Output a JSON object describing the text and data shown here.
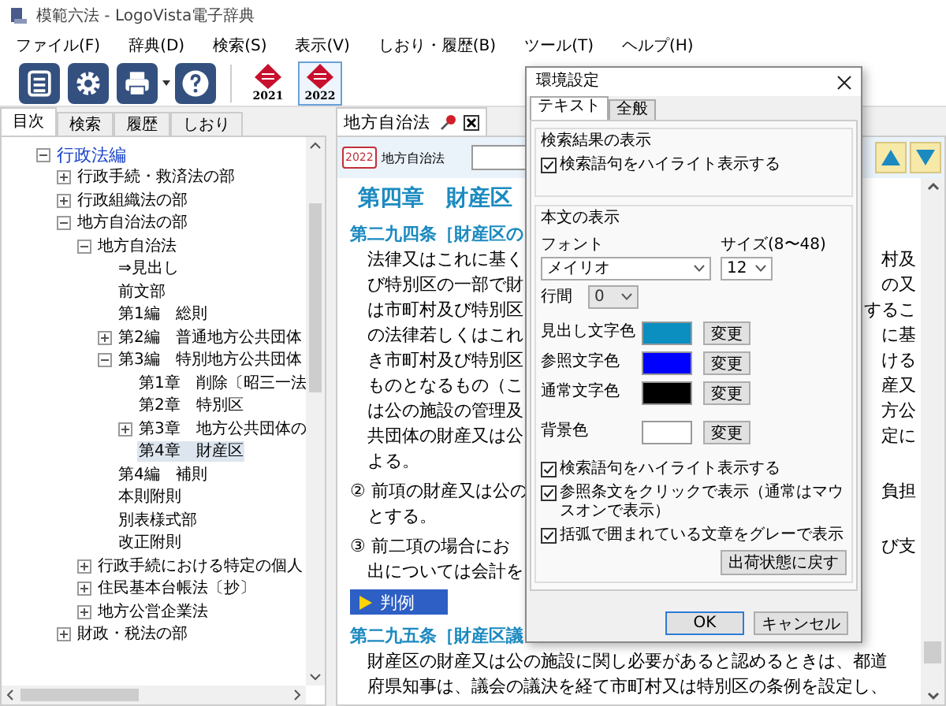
{
  "window": {
    "title": "模範六法 - LogoVista電子辞典"
  },
  "menu": [
    "ファイル(F)",
    "辞典(D)",
    "検索(S)",
    "表示(V)",
    "しおり・履歴(B)",
    "ツール(T)",
    "ヘルプ(H)"
  ],
  "toolbar": {
    "books": [
      {
        "year": "2021",
        "selected": false
      },
      {
        "year": "2022",
        "selected": true
      }
    ]
  },
  "sidebar": {
    "tabs": [
      {
        "label": "目次",
        "selected": true
      },
      {
        "label": "検索",
        "selected": false
      },
      {
        "label": "履歴",
        "selected": false
      },
      {
        "label": "しおり",
        "selected": false
      }
    ],
    "tree": [
      {
        "label": "行政法編",
        "expanded": true,
        "selected": false,
        "children": [
          {
            "label": "行政手続・救済法の部",
            "expanded": false,
            "selected": false
          },
          {
            "label": "行政組織法の部",
            "expanded": false,
            "selected": false
          },
          {
            "label": "地方自治法の部",
            "expanded": true,
            "selected": false,
            "children": [
              {
                "label": "地方自治法",
                "expanded": true,
                "selected": false,
                "children": [
                  {
                    "label": "⇒見出し",
                    "selected": false
                  },
                  {
                    "label": "前文部",
                    "selected": false
                  },
                  {
                    "label": "第1編　総則",
                    "selected": false
                  },
                  {
                    "label": "第2編　普通地方公共団体",
                    "expanded": false,
                    "selected": false
                  },
                  {
                    "label": "第3編　特別地方公共団体",
                    "expanded": true,
                    "selected": false,
                    "children": [
                      {
                        "label": "第1章　削除〔昭三一法",
                        "selected": false
                      },
                      {
                        "label": "第2章　特別区",
                        "selected": false
                      },
                      {
                        "label": "第3章　地方公共団体の",
                        "expanded": false,
                        "selected": false
                      },
                      {
                        "label": "第4章　財産区",
                        "selected": true
                      }
                    ]
                  },
                  {
                    "label": "第4編　補則",
                    "selected": false
                  },
                  {
                    "label": "本則附則",
                    "selected": false
                  },
                  {
                    "label": "別表様式部",
                    "selected": false
                  },
                  {
                    "label": "改正附則",
                    "selected": false
                  }
                ]
              },
              {
                "label": "行政手続における特定の個人",
                "expanded": false,
                "selected": false
              },
              {
                "label": "住民基本台帳法〔抄〕",
                "expanded": false,
                "selected": false
              },
              {
                "label": "地方公営企業法",
                "expanded": false,
                "selected": false
              }
            ]
          },
          {
            "label": "財政・税法の部",
            "expanded": false,
            "selected": false
          }
        ]
      }
    ]
  },
  "document": {
    "tab": "地方自治法",
    "badge": "2022",
    "source": "地方自治法",
    "blocks": [
      {
        "kind": "chapter",
        "text": "第四章　財産区"
      },
      {
        "kind": "article",
        "text": "第二九四条［財産区の"
      },
      {
        "kind": "body",
        "text": "法律又はこれに基く",
        "right": "村及"
      },
      {
        "kind": "body",
        "text": "び特別区の一部で財",
        "right": "の又"
      },
      {
        "kind": "body",
        "text": "は市町村及び特別区",
        "right": "するこ"
      },
      {
        "kind": "body",
        "text": "の法律若しくはこれ",
        "right": "に基"
      },
      {
        "kind": "body",
        "text": "き市町村及び特別区",
        "right": "ける"
      },
      {
        "kind": "body",
        "text": "ものとなるもの（こ",
        "right": "産又"
      },
      {
        "kind": "body",
        "text": "は公の施設の管理及",
        "right": "方公"
      },
      {
        "kind": "body",
        "text": "共団体の財産又は公",
        "right": "定に"
      },
      {
        "kind": "body",
        "text": "よる。"
      },
      {
        "kind": "para",
        "text": "② 前項の財産又は公の",
        "right": "負担"
      },
      {
        "kind": "body",
        "text": "とする。"
      },
      {
        "kind": "para",
        "text": "③ 前二項の場合にお",
        "right": "び支"
      },
      {
        "kind": "body",
        "text": "出については会計を"
      },
      {
        "kind": "button",
        "text": "判例"
      },
      {
        "kind": "article",
        "text": "第二九五条［財産区議"
      },
      {
        "kind": "body",
        "text": "財産区の財産又は公の施設に関し必要があると認めるときは、都道"
      },
      {
        "kind": "body",
        "text": "府県知事は、議会の議決を経て市町村又は特別区の条例を設定し、"
      }
    ]
  },
  "dialog": {
    "title": "環境設定",
    "tabs": [
      {
        "label": "テキスト",
        "selected": true
      },
      {
        "label": "全般",
        "selected": false
      }
    ],
    "search_group": {
      "title": "検索結果の表示",
      "options": [
        {
          "label": "検索語句をハイライト表示する",
          "checked": true
        }
      ]
    },
    "text_group": {
      "title": "本文の表示",
      "font": {
        "label": "フォント",
        "value": "メイリオ"
      },
      "size": {
        "label": "サイズ(8〜48)",
        "value": "12"
      },
      "line_spacing": {
        "label": "行間",
        "value": "0",
        "disabled": true
      },
      "colors": [
        {
          "label": "見出し文字色",
          "color": "#0b8ec0",
          "button": "変更"
        },
        {
          "label": "参照文字色",
          "color": "#0000ff",
          "button": "変更"
        },
        {
          "label": "通常文字色",
          "color": "#000000",
          "button": "変更"
        },
        {
          "label": "背景色",
          "color": "#ffffff",
          "button": "変更"
        }
      ],
      "options": [
        {
          "label": "検索語句をハイライト表示する",
          "checked": true
        },
        {
          "label": "参照条文をクリックで表示（通常はマウスオンで表示）",
          "checked": true
        },
        {
          "label": "括弧で囲まれている文章をグレーで表示",
          "checked": true
        }
      ],
      "reset_button": "出荷状態に戻す"
    },
    "buttons": [
      {
        "label": "OK",
        "default": true
      },
      {
        "label": "キャンセル",
        "default": false
      }
    ]
  }
}
